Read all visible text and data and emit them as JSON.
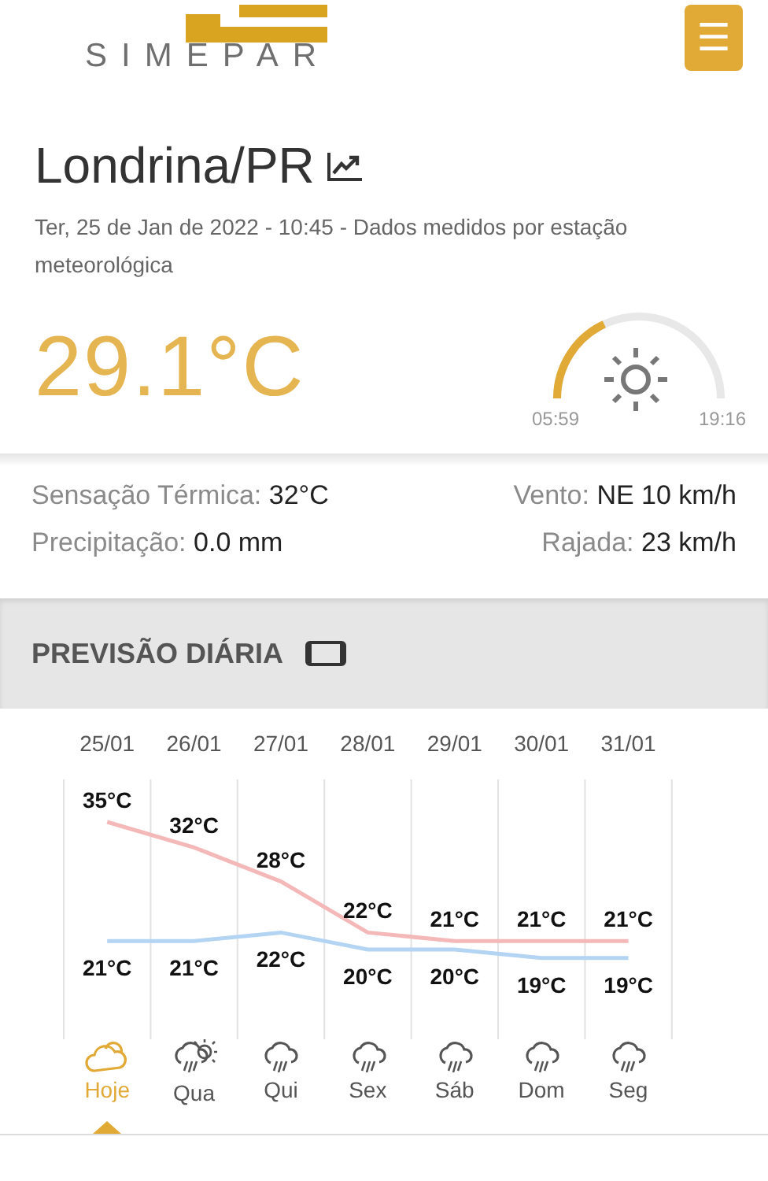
{
  "header": {
    "logo": "SIMEPAR",
    "menu_icon": "☰"
  },
  "current": {
    "city": "Londrina/PR",
    "subtitle": "Ter, 25 de Jan de 2022 - 10:45 - Dados medidos por estação meteorológica",
    "temperature": "29.1°C",
    "sunrise": "05:59",
    "sunset": "19:16"
  },
  "details": [
    {
      "label": "Sensação Térmica:",
      "value": "32°C"
    },
    {
      "label": "Vento:",
      "value": "NE 10 km/h"
    },
    {
      "label": "Precipitação:",
      "value": "0.0 mm"
    },
    {
      "label": "Rajada:",
      "value": "23 km/h"
    }
  ],
  "forecast": {
    "title": "PREVISÃO DIÁRIA",
    "chart_data": {
      "type": "line",
      "categories": [
        "25/01",
        "26/01",
        "27/01",
        "28/01",
        "29/01",
        "30/01",
        "31/01"
      ],
      "data_labels": true,
      "series": [
        {
          "color": "#f4b8b8",
          "values": [
            35,
            32,
            28,
            22,
            21,
            21,
            21
          ],
          "value_labels": [
            "35°C",
            "32°C",
            "28°C",
            "22°C",
            "21°C",
            "21°C",
            "21°C"
          ]
        },
        {
          "color": "#b4d4f4",
          "values": [
            21,
            21,
            22,
            20,
            20,
            19,
            19
          ],
          "value_labels": [
            "21°C",
            "21°C",
            "22°C",
            "20°C",
            "20°C",
            "19°C",
            "19°C"
          ]
        }
      ]
    },
    "days": [
      {
        "label": "Hoje",
        "kind": "cloud",
        "selected": true
      },
      {
        "label": "Qua",
        "kind": "sun-rain",
        "selected": false
      },
      {
        "label": "Qui",
        "kind": "rain",
        "selected": false
      },
      {
        "label": "Sex",
        "kind": "rain",
        "selected": false
      },
      {
        "label": "Sáb",
        "kind": "rain",
        "selected": false
      },
      {
        "label": "Dom",
        "kind": "rain",
        "selected": false
      },
      {
        "label": "Seg",
        "kind": "rain",
        "selected": false
      }
    ]
  }
}
